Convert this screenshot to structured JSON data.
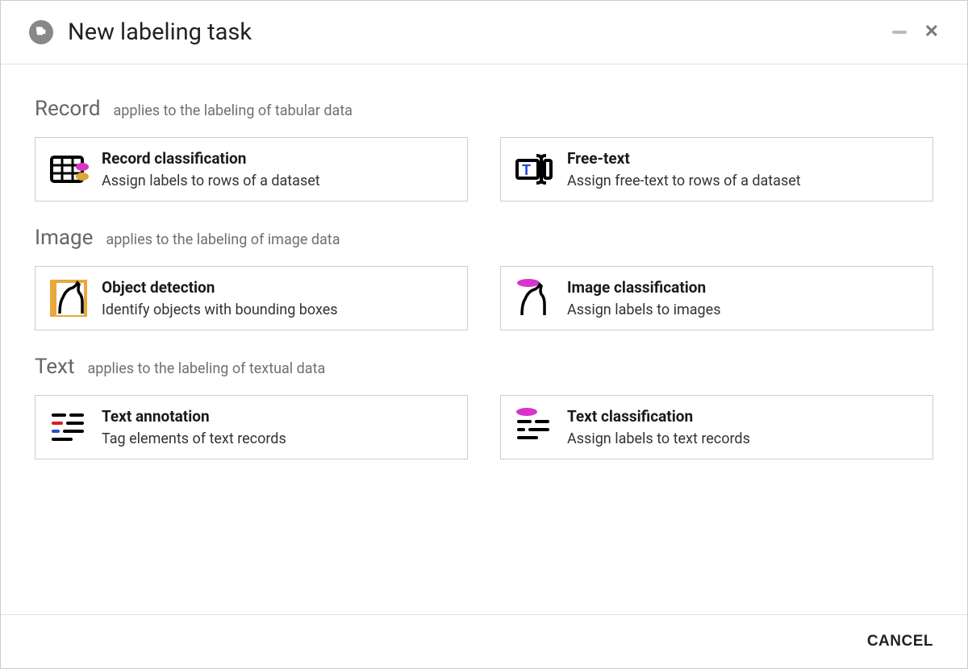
{
  "header": {
    "title": "New labeling task"
  },
  "sections": {
    "record": {
      "title": "Record",
      "subtitle": "applies to the labeling of tabular data",
      "cards": [
        {
          "title": "Record classification",
          "desc": "Assign labels to rows of a dataset"
        },
        {
          "title": "Free-text",
          "desc": "Assign free-text to rows of a dataset"
        }
      ]
    },
    "image": {
      "title": "Image",
      "subtitle": "applies to the labeling of image data",
      "cards": [
        {
          "title": "Object detection",
          "desc": "Identify objects with bounding boxes"
        },
        {
          "title": "Image classification",
          "desc": "Assign labels to images"
        }
      ]
    },
    "text": {
      "title": "Text",
      "subtitle": "applies to the labeling of textual data",
      "cards": [
        {
          "title": "Text annotation",
          "desc": "Tag elements of text records"
        },
        {
          "title": "Text classification",
          "desc": "Assign labels to text records"
        }
      ]
    }
  },
  "footer": {
    "cancel": "CANCEL"
  }
}
